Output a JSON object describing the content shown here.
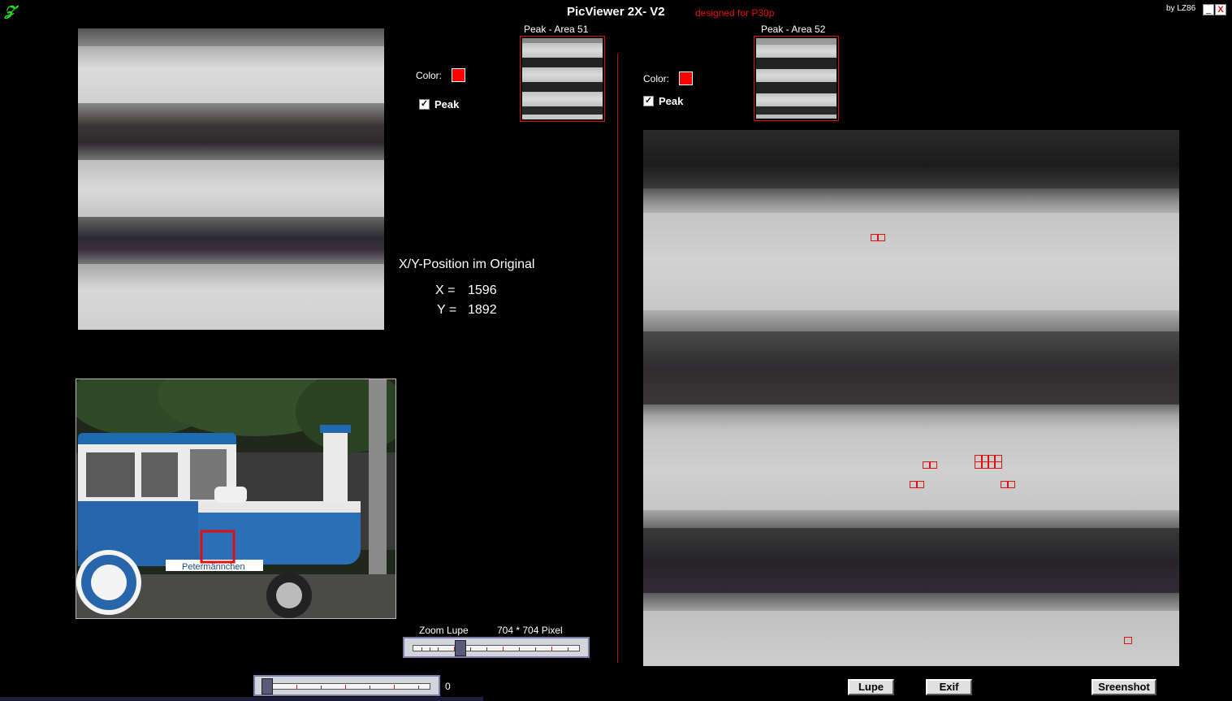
{
  "app": {
    "title": "PicViewer 2X- V2",
    "subtitle": "designed for P30p",
    "byline": "by LZ86",
    "minimize": "_",
    "close": "X"
  },
  "left_panel": {
    "color_label": "Color:",
    "color_value": "#ff0000",
    "peak_label": "Peak",
    "peak_checked": true,
    "peak_preview_title": "Peak - Area 51"
  },
  "right_panel": {
    "color_label": "Color:",
    "color_value": "#ff0000",
    "peak_label": "Peak",
    "peak_checked": true,
    "peak_preview_title": "Peak - Area 52"
  },
  "position": {
    "title": "X/Y-Position im Original",
    "x_label": "X =",
    "x_value": "1596",
    "y_label": "Y =",
    "y_value": "1892"
  },
  "zoom": {
    "label": "Zoom Lupe",
    "size": "704 * 704 Pixel"
  },
  "bottom_slider": {
    "value": "0"
  },
  "buttons": {
    "lupe": "Lupe",
    "exif": "Exif",
    "screenshot": "Sreenshot"
  },
  "thumbnail": {
    "sign_text": "Petermännchen"
  },
  "colors": {
    "accent_red": "#e01010",
    "logo_green": "#1fdc1f"
  }
}
